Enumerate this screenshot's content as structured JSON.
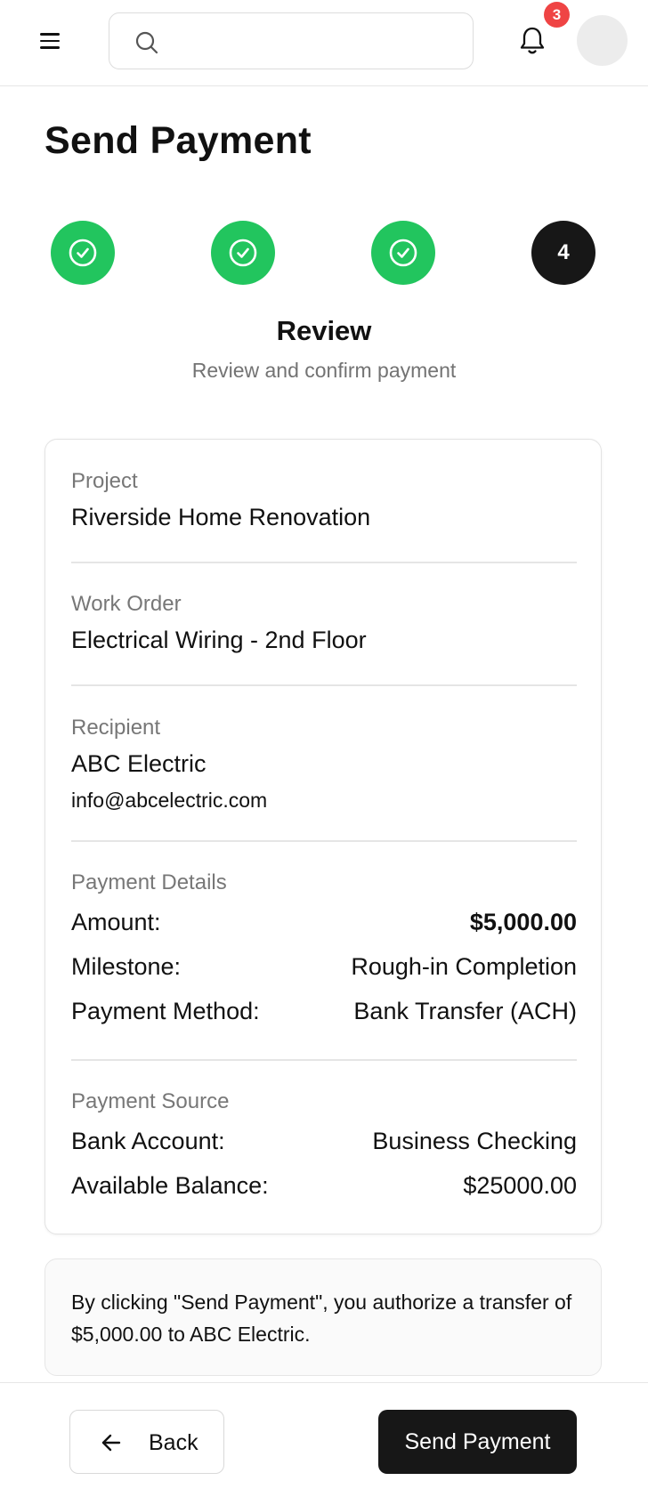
{
  "header": {
    "search": {
      "value": "",
      "placeholder": ""
    },
    "notifications": {
      "count": "3"
    }
  },
  "page": {
    "title": "Send Payment"
  },
  "stepper": {
    "steps": [
      {
        "state": "done",
        "icon": "check-circle-icon"
      },
      {
        "state": "done",
        "icon": "check-circle-icon"
      },
      {
        "state": "done",
        "icon": "check-circle-icon"
      },
      {
        "state": "current",
        "number": "4"
      }
    ],
    "current_title": "Review",
    "current_subtitle": "Review and confirm payment",
    "colors": {
      "done": "#22c55e",
      "current": "#171717"
    }
  },
  "review": {
    "project": {
      "label": "Project",
      "value": "Riverside Home Renovation"
    },
    "work_order": {
      "label": "Work Order",
      "value": "Electrical Wiring - 2nd Floor"
    },
    "recipient": {
      "label": "Recipient",
      "name": "ABC Electric",
      "email": "info@abcelectric.com"
    },
    "payment_details": {
      "label": "Payment Details",
      "rows": [
        {
          "key": "Amount:",
          "value": "$5,000.00"
        },
        {
          "key": "Milestone:",
          "value": "Rough-in Completion"
        },
        {
          "key": "Payment Method:",
          "value": "Bank Transfer (ACH)"
        }
      ]
    },
    "payment_source": {
      "label": "Payment Source",
      "rows": [
        {
          "key": "Bank Account:",
          "value": "Business Checking"
        },
        {
          "key": "Available Balance:",
          "value": "$25000.00"
        }
      ]
    }
  },
  "notice": {
    "text": "By clicking \"Send Payment\", you authorize a transfer of $5,000.00 to ABC Electric."
  },
  "footer": {
    "back_label": "Back",
    "send_label": "Send Payment"
  },
  "colors": {
    "badge": "#ef4444",
    "primary_button": "#171717"
  }
}
